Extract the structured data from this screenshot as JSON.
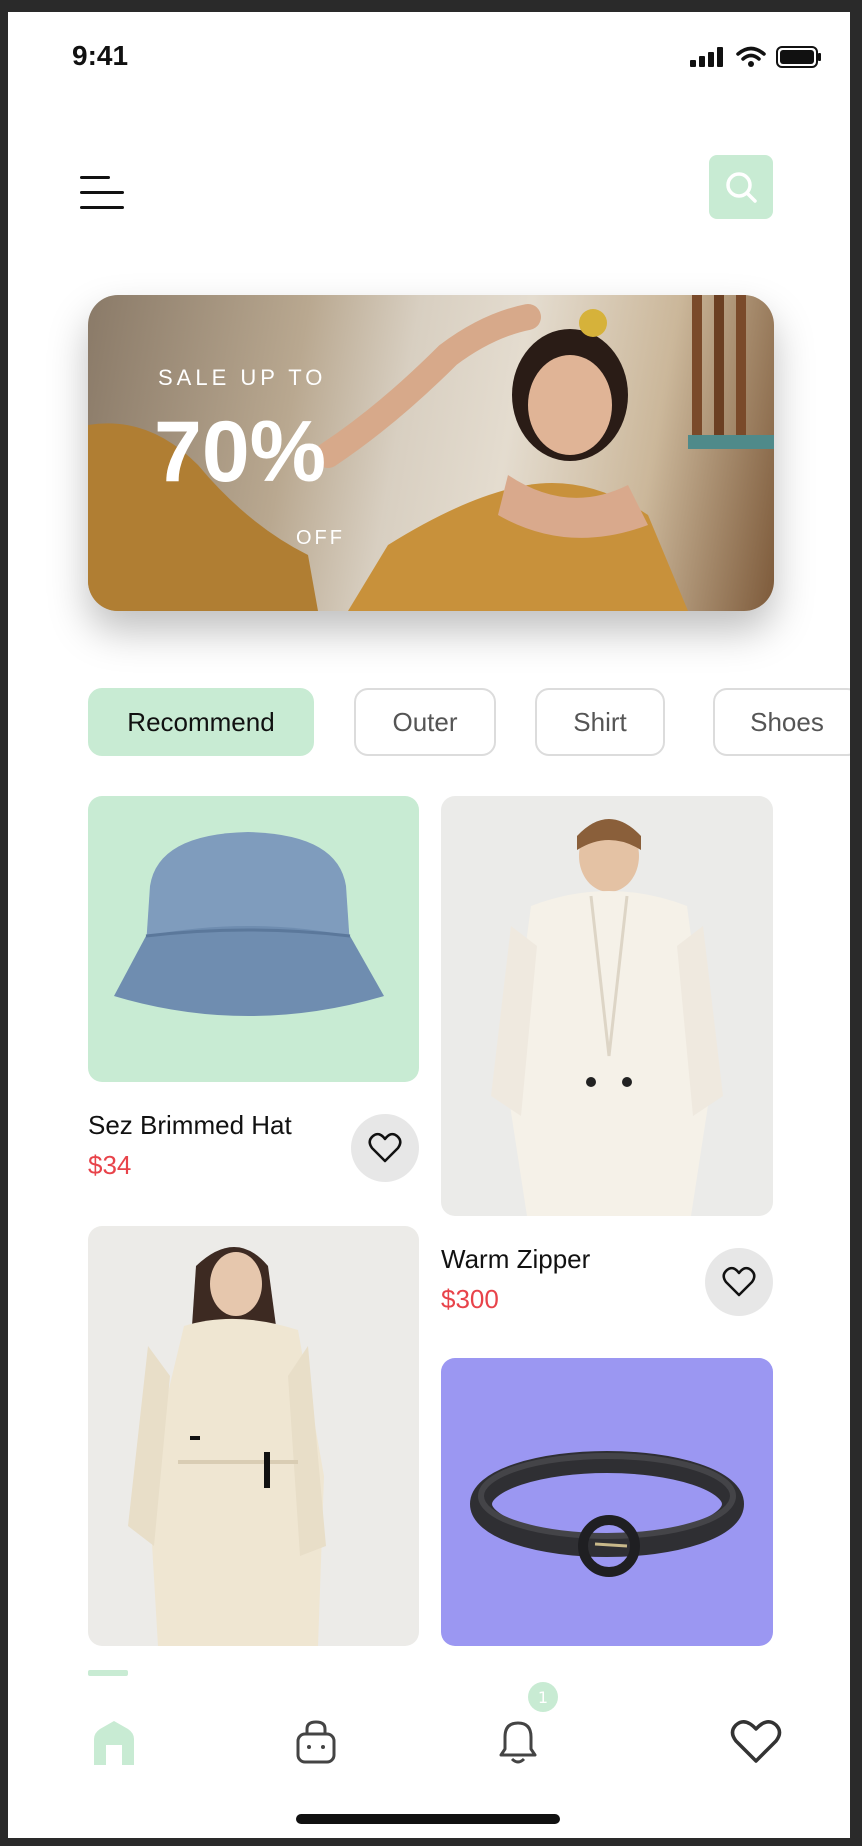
{
  "status_bar": {
    "time": "9:41"
  },
  "banner": {
    "sale_text": "SALE UP TO",
    "percent": "70%",
    "off_text": "OFF"
  },
  "categories": [
    "Recommend",
    "Outer",
    "Shirt",
    "Shoes"
  ],
  "products": [
    {
      "name": "Sez Brimmed Hat",
      "price": "$34"
    },
    {
      "name": "Warm Zipper",
      "price": "$300"
    }
  ],
  "notifications": {
    "badge_count": "1"
  },
  "colors": {
    "accent": "#c8ebd3",
    "price": "#e8434a",
    "belt_bg": "#9b97f2"
  },
  "icons": [
    "menu-icon",
    "search-icon",
    "heart-icon",
    "home-icon",
    "bag-icon",
    "bell-icon"
  ]
}
